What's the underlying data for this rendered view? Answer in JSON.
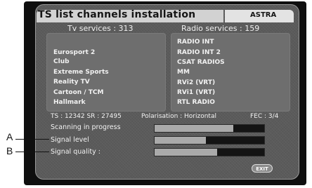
{
  "header": {
    "title": "TS list channels installation",
    "satellite": "ASTRA"
  },
  "tv_services": {
    "label": "Tv services : 313",
    "items": [
      "Eurosport 2",
      "Club",
      "Extreme Sports",
      "Reality TV",
      "Cartoon / TCM",
      "Hallmark"
    ]
  },
  "radio_services": {
    "label": "Radio services : 159",
    "items": [
      "RADIO INT",
      "RADIO INT 2",
      "CSAT RADIOS",
      "MM",
      "RVi2 (VRT)",
      "RVi1 (VRT)",
      "RTL RADIO"
    ]
  },
  "ts_info": {
    "ts_sr": "TS : 12342 SR : 27495",
    "polarisation": "Polarisation : Horizontal",
    "fec": "FEC : 3/4"
  },
  "status": {
    "scanning_label": "Scanning in progress",
    "scanning_progress": 0.72,
    "signal_level_label": "Signal level",
    "signal_level": 0.47,
    "signal_quality_label": "Signal quality :",
    "signal_quality": 0.57
  },
  "exit_label": "EXIT",
  "callouts": {
    "a": "A",
    "b": "B"
  },
  "colors": {
    "screen_bg": "#5b5b5b",
    "panel_bg": "#6e6e6e",
    "bar_fill": "#aaaaaa",
    "bar_bg": "#141414"
  }
}
